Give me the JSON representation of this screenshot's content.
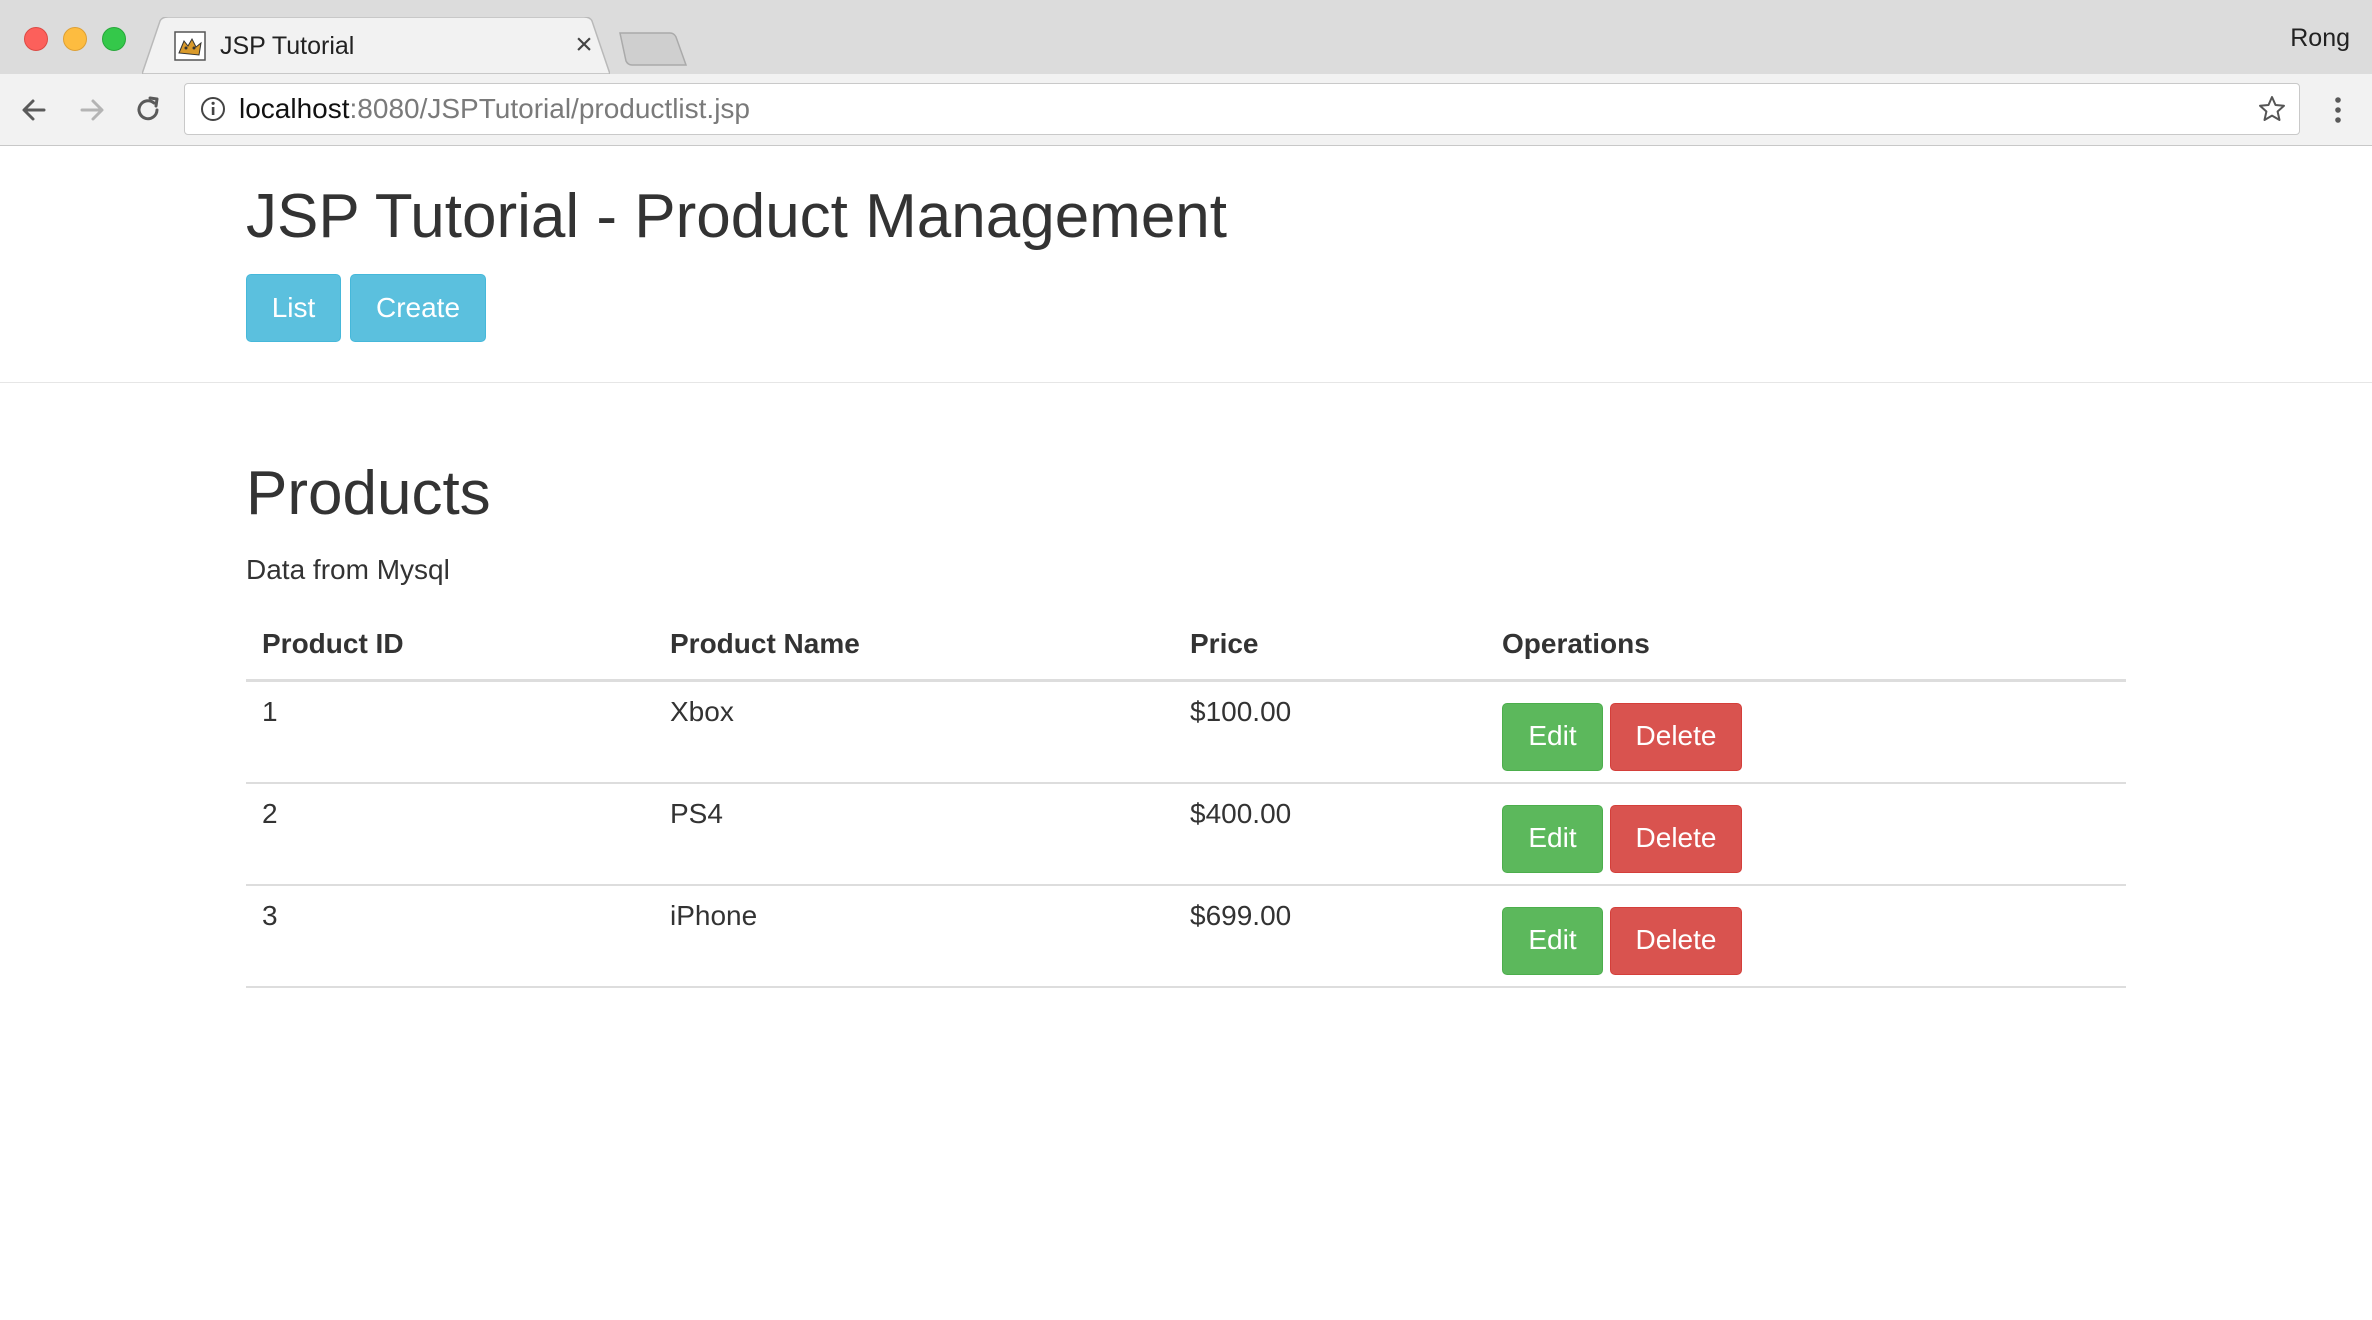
{
  "browser": {
    "tab_title": "JSP Tutorial",
    "tab_close": "×",
    "profile_name": "Rong",
    "url_host": "localhost",
    "url_rest": ":8080/JSPTutorial/productlist.jsp",
    "icons": {
      "back": "back-arrow-icon",
      "forward": "forward-arrow-icon",
      "reload": "reload-icon",
      "info": "info-icon",
      "bookmark": "star-icon",
      "menu": "kebab-menu-icon",
      "favicon": "tomcat-favicon-icon"
    }
  },
  "header": {
    "title": "JSP Tutorial - Product Management",
    "list_label": "List",
    "create_label": "Create"
  },
  "main": {
    "title": "Products",
    "subtitle": "Data from Mysql",
    "columns": [
      "Product ID",
      "Product Name",
      "Price",
      "Operations"
    ],
    "rows": [
      {
        "id": "1",
        "name": "Xbox",
        "price": "$100.00",
        "edit": "Edit",
        "delete": "Delete"
      },
      {
        "id": "2",
        "name": "PS4",
        "price": "$400.00",
        "edit": "Edit",
        "delete": "Delete"
      },
      {
        "id": "3",
        "name": "iPhone",
        "price": "$699.00",
        "edit": "Edit",
        "delete": "Delete"
      }
    ]
  },
  "colors": {
    "info": "#5bc0de",
    "success": "#5cb85c",
    "danger": "#d9534f",
    "text": "#333333"
  }
}
